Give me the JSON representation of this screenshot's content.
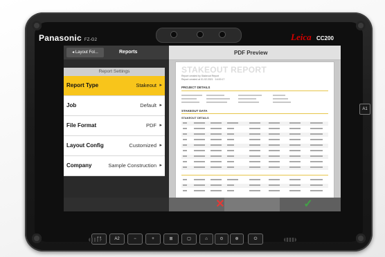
{
  "device": {
    "brand": "Panasonic",
    "model": "FZ-G2",
    "right_brand": "Leica",
    "right_model": "CC200",
    "side_button": "A1"
  },
  "app": {
    "back_label": "Layout Fol...",
    "screen_title": "Reports",
    "settings_header": "Report Settings",
    "settings": [
      {
        "label": "Report Type",
        "value": "Stakeout",
        "active": true
      },
      {
        "label": "Job",
        "value": "Default",
        "active": false
      },
      {
        "label": "File Format",
        "value": "PDF",
        "active": false
      },
      {
        "label": "Layout Config",
        "value": "Customized",
        "active": false
      },
      {
        "label": "Company",
        "value": "Sample Construction",
        "active": false
      }
    ],
    "pdf_title": "PDF Preview",
    "pdf": {
      "report_title": "STAKEOUT REPORT",
      "sub1": "Report created by Stakeout Report",
      "sub2": "Report created at 01.02.2021 · 14:00:17",
      "project_details_heading": "PROJECT DETAILS",
      "stakeout_data_heading": "STAKEOUT DATA",
      "stakeout_details_heading": "STAKEOUT DETAILS"
    },
    "cancel_icon": "x-icon",
    "confirm_icon": "check-icon"
  },
  "bottom_keys": [
    "A1",
    "A2",
    "−",
    "+",
    "⊞",
    "▢",
    "⌂",
    "⊙",
    "⊕",
    "⏻"
  ],
  "colors": {
    "accent": "#f8c51b",
    "cancel": "#e53935",
    "confirm": "#43a047",
    "leica_red": "#d40000"
  }
}
